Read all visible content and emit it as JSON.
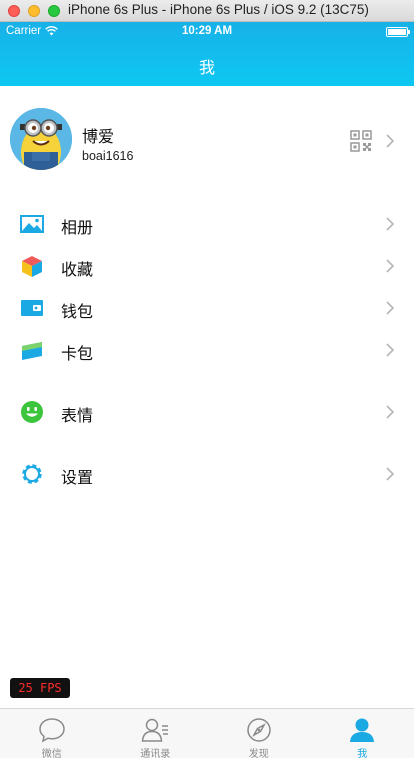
{
  "simulator": {
    "title": "iPhone 6s Plus - iPhone 6s Plus / iOS 9.2 (13C75)"
  },
  "status_bar": {
    "carrier": "Carrier",
    "time": "10:29 AM"
  },
  "nav": {
    "title": "我"
  },
  "profile": {
    "name": "博爱",
    "id": "boai1616",
    "icon": "qr-code-icon"
  },
  "menu": [
    {
      "label": "相册",
      "icon": "photo-album-icon"
    },
    {
      "label": "收藏",
      "icon": "favorites-cube-icon"
    },
    {
      "label": "钱包",
      "icon": "wallet-icon"
    },
    {
      "label": "卡包",
      "icon": "card-pack-icon"
    },
    {
      "label": "表情",
      "icon": "smiley-face-icon"
    },
    {
      "label": "设置",
      "icon": "settings-gear-icon"
    }
  ],
  "fps": "25 FPS",
  "tabbar": {
    "tabs": [
      {
        "label": "微信",
        "icon": "chat-bubble-icon",
        "active": false
      },
      {
        "label": "通讯录",
        "icon": "contacts-icon",
        "active": false
      },
      {
        "label": "发现",
        "icon": "compass-icon",
        "active": false
      },
      {
        "label": "我",
        "icon": "person-icon",
        "active": true
      }
    ]
  },
  "colors": {
    "accent": "#1aa9e3",
    "header": "#17b1e8",
    "inactive": "#8a8a8a"
  }
}
